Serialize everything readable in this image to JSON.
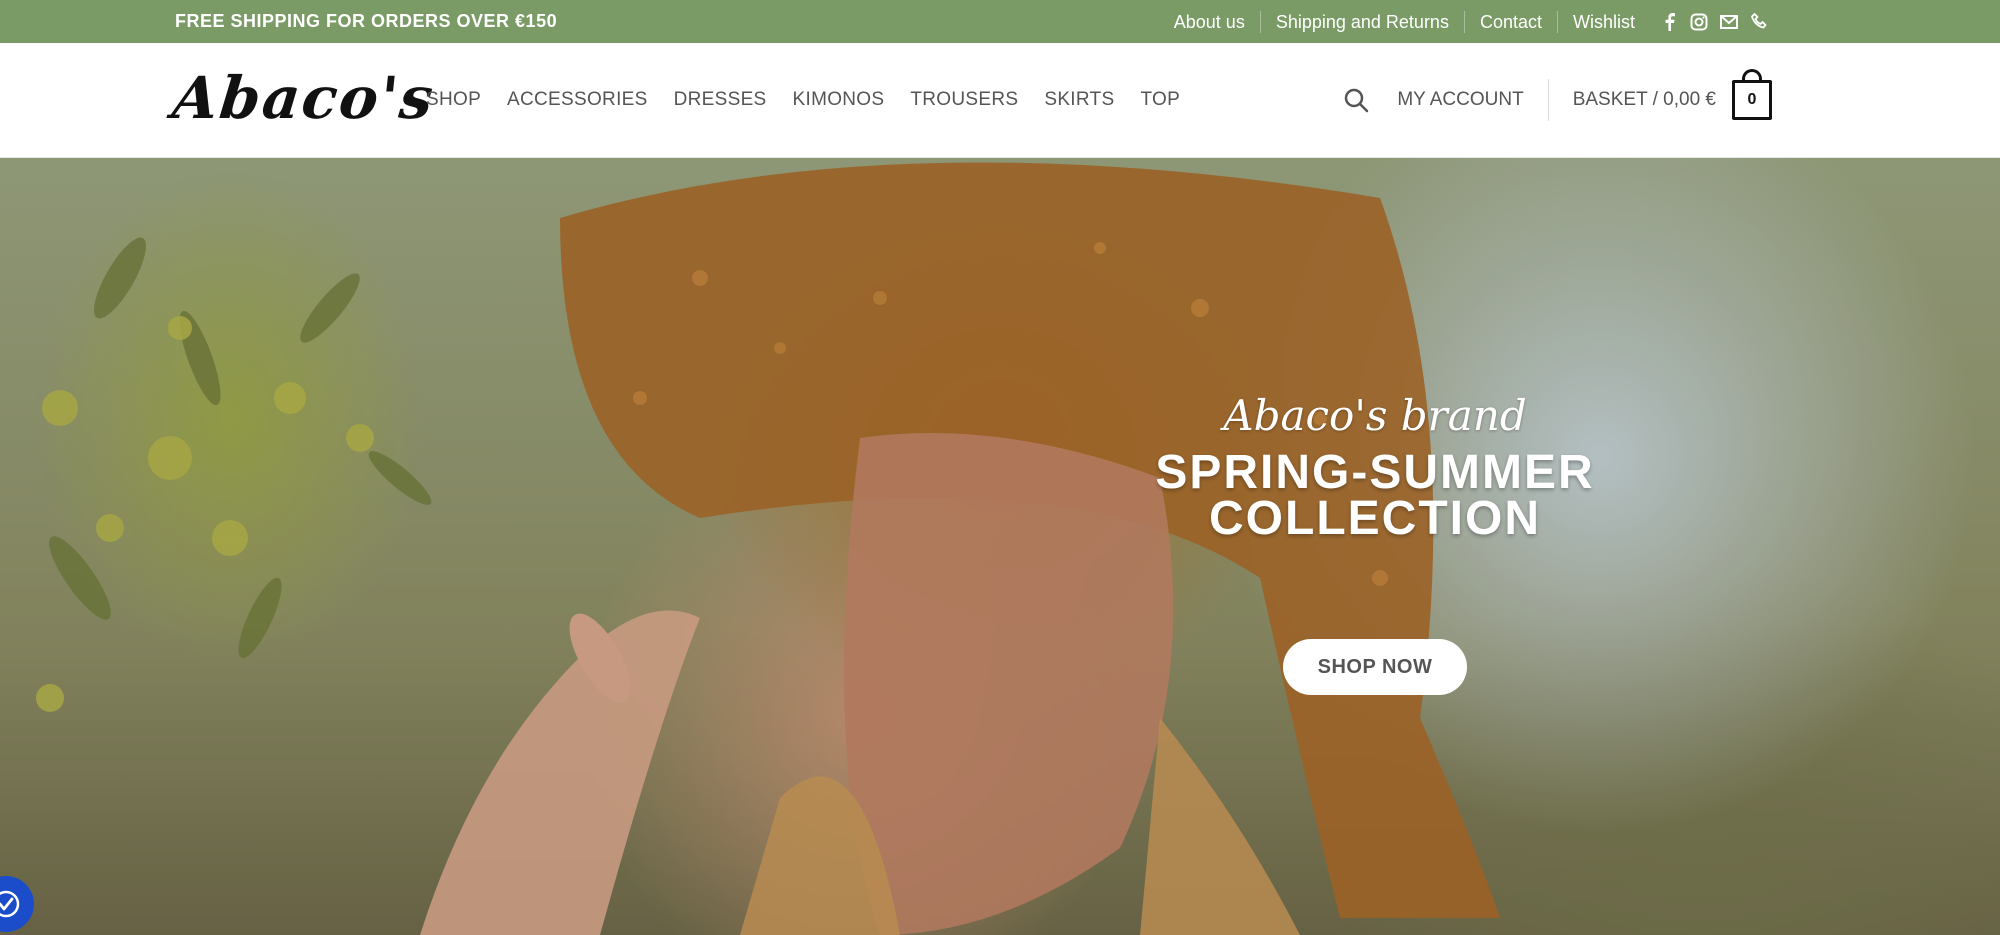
{
  "topbar": {
    "promo": "FREE SHIPPING FOR ORDERS OVER €150",
    "links": [
      "About us",
      "Shipping and Returns",
      "Contact",
      "Wishlist"
    ],
    "social_icons": [
      "facebook-icon",
      "instagram-icon",
      "email-icon",
      "phone-icon"
    ],
    "background": "#7a9a66"
  },
  "header": {
    "logo": "Abaco's",
    "nav": [
      "SHOP",
      "ACCESSORIES",
      "DRESSES",
      "KIMONOS",
      "TROUSERS",
      "SKIRTS",
      "TOP"
    ],
    "account": "MY ACCOUNT",
    "basket": "BASKET / 0,00 €",
    "basket_count": "0"
  },
  "hero": {
    "kicker": "Abaco's brand",
    "title_line1": "SPRING-SUMMER",
    "title_line2": "COLLECTION",
    "cta": "SHOP NOW"
  }
}
